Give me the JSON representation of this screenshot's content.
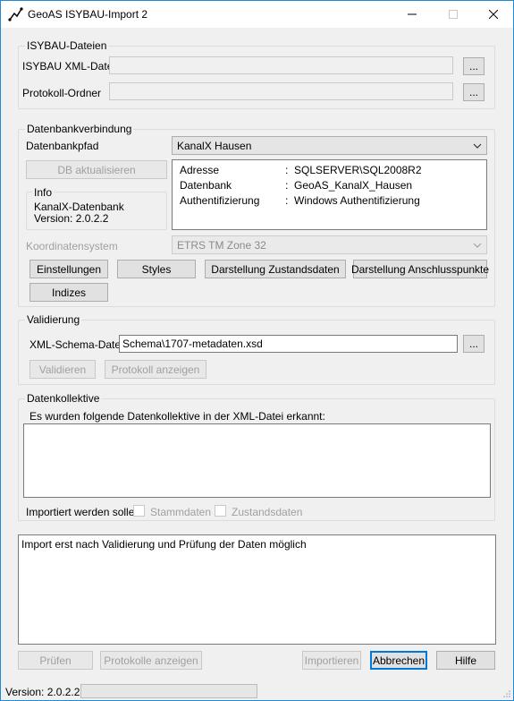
{
  "window": {
    "title": "GeoAS ISYBAU-Import 2"
  },
  "isybau": {
    "group_title": "ISYBAU-Dateien",
    "xml_label": "ISYBAU XML-Datei",
    "xml_value": "",
    "protocol_label": "Protokoll-Ordner",
    "protocol_value": "",
    "browse_label": "..."
  },
  "db": {
    "group_title": "Datenbankverbindung",
    "path_label": "Datenbankpfad",
    "path_value": "KanalX Hausen",
    "update_button": "DB aktualisieren",
    "info_title": "Info",
    "info_line1": "KanalX-Datenbank",
    "info_line2": "Version: 2.0.2.2",
    "details": [
      {
        "key": "Adresse",
        "sep": ":",
        "value": "SQLSERVER\\SQL2008R2"
      },
      {
        "key": "Datenbank",
        "sep": ":",
        "value": "GeoAS_KanalX_Hausen"
      },
      {
        "key": "Authentifizierung",
        "sep": ":",
        "value": "Windows Authentifizierung"
      }
    ],
    "crs_label": "Koordinatensystem",
    "crs_value": "ETRS TM Zone 32",
    "buttons": {
      "settings": "Einstellungen",
      "styles": "Styles",
      "state": "Darstellung Zustandsdaten",
      "connection": "Darstellung Anschlusspunkte",
      "indices": "Indizes"
    }
  },
  "validation": {
    "group_title": "Validierung",
    "schema_label": "XML-Schema-Datei",
    "schema_value": "Schema\\1707-metadaten.xsd",
    "browse_label": "...",
    "validate_button": "Validieren",
    "show_log_button": "Protokoll anzeigen"
  },
  "collectives": {
    "group_title": "Datenkollektive",
    "found_label": "Es wurden folgende Datenkollektive in der XML-Datei erkannt:",
    "import_label": "Importiert werden sollen",
    "master_label": "Stammdaten",
    "state_label": "Zustandsdaten"
  },
  "log": {
    "text": "Import erst nach Validierung und Prüfung der Daten möglich"
  },
  "footer": {
    "check": "Prüfen",
    "show_logs": "Protokolle anzeigen",
    "import": "Importieren",
    "cancel": "Abbrechen",
    "help": "Hilfe"
  },
  "status": {
    "version": "Version: 2.0.2.2"
  },
  "colors": {
    "accent": "#0078d7",
    "window_border": "#1f8bd8"
  }
}
